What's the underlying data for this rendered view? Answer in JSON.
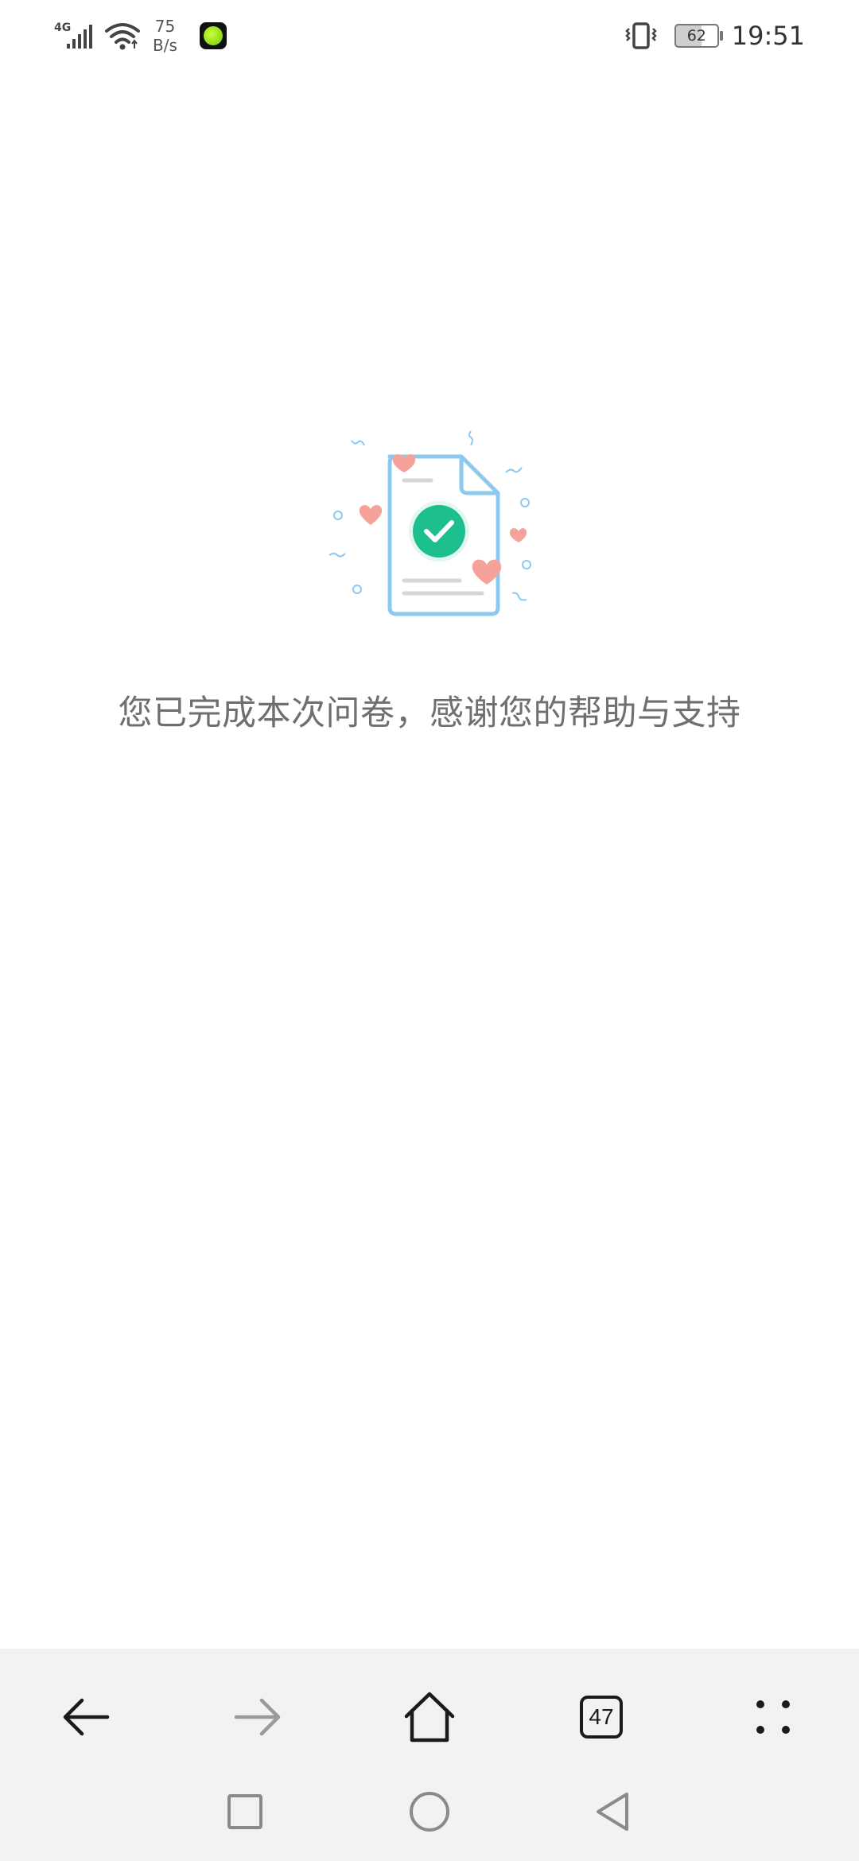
{
  "status_bar": {
    "network_type": "4G",
    "speed_value": "75",
    "speed_unit": "B/s",
    "battery_level": "62",
    "time": "19:51",
    "icons": [
      "cellular-signal-icon",
      "wifi-icon",
      "app-notification-icon",
      "vibrate-icon",
      "battery-icon"
    ]
  },
  "main": {
    "illustration": "survey-complete-document-icon",
    "message": "您已完成本次问卷，感谢您的帮助与支持"
  },
  "toolbar": {
    "tabs_count": "47",
    "buttons": [
      "back-arrow-icon",
      "forward-arrow-icon",
      "home-icon",
      "tabs-icon",
      "menu-icon"
    ]
  },
  "system_nav": {
    "buttons": [
      "recent-apps-icon",
      "home-circle-icon",
      "back-triangle-icon"
    ]
  },
  "colors": {
    "accent_green": "#1dbf8e",
    "doc_outline": "#8cc8f0",
    "heart": "#f5a39a",
    "toolbar_bg": "#f1f2f4",
    "message_text": "#6f6f6f"
  }
}
